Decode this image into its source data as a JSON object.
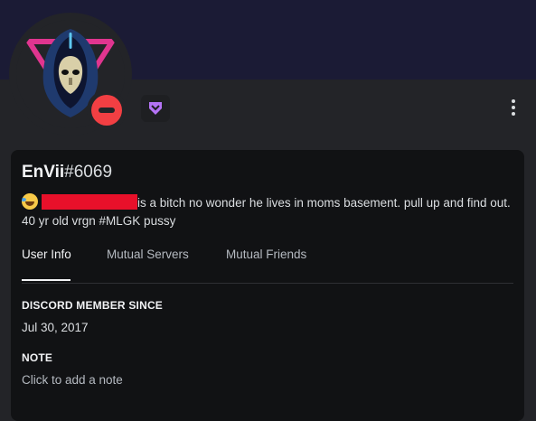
{
  "profile": {
    "username": "EnVii",
    "discriminator": "#6069",
    "status": "do-not-disturb",
    "badge_icon": "nitro-badge-icon",
    "bio_line1_suffix": "is a bitch no wonder he lives in moms basement. pull up and find out.",
    "bio_line2": "40 yr old vrgn #MLGK pussy"
  },
  "tabs": [
    {
      "label": "User Info"
    },
    {
      "label": "Mutual Servers"
    },
    {
      "label": "Mutual Friends"
    }
  ],
  "info": {
    "member_since_title": "DISCORD MEMBER SINCE",
    "member_since_value": "Jul 30, 2017",
    "note_title": "NOTE",
    "note_placeholder": "Click to add a note"
  },
  "colors": {
    "banner": "#1b1b35",
    "panel": "#111214",
    "dnd": "#f23f43",
    "nitro": "#b473f5",
    "redaction": "#e8102a"
  }
}
